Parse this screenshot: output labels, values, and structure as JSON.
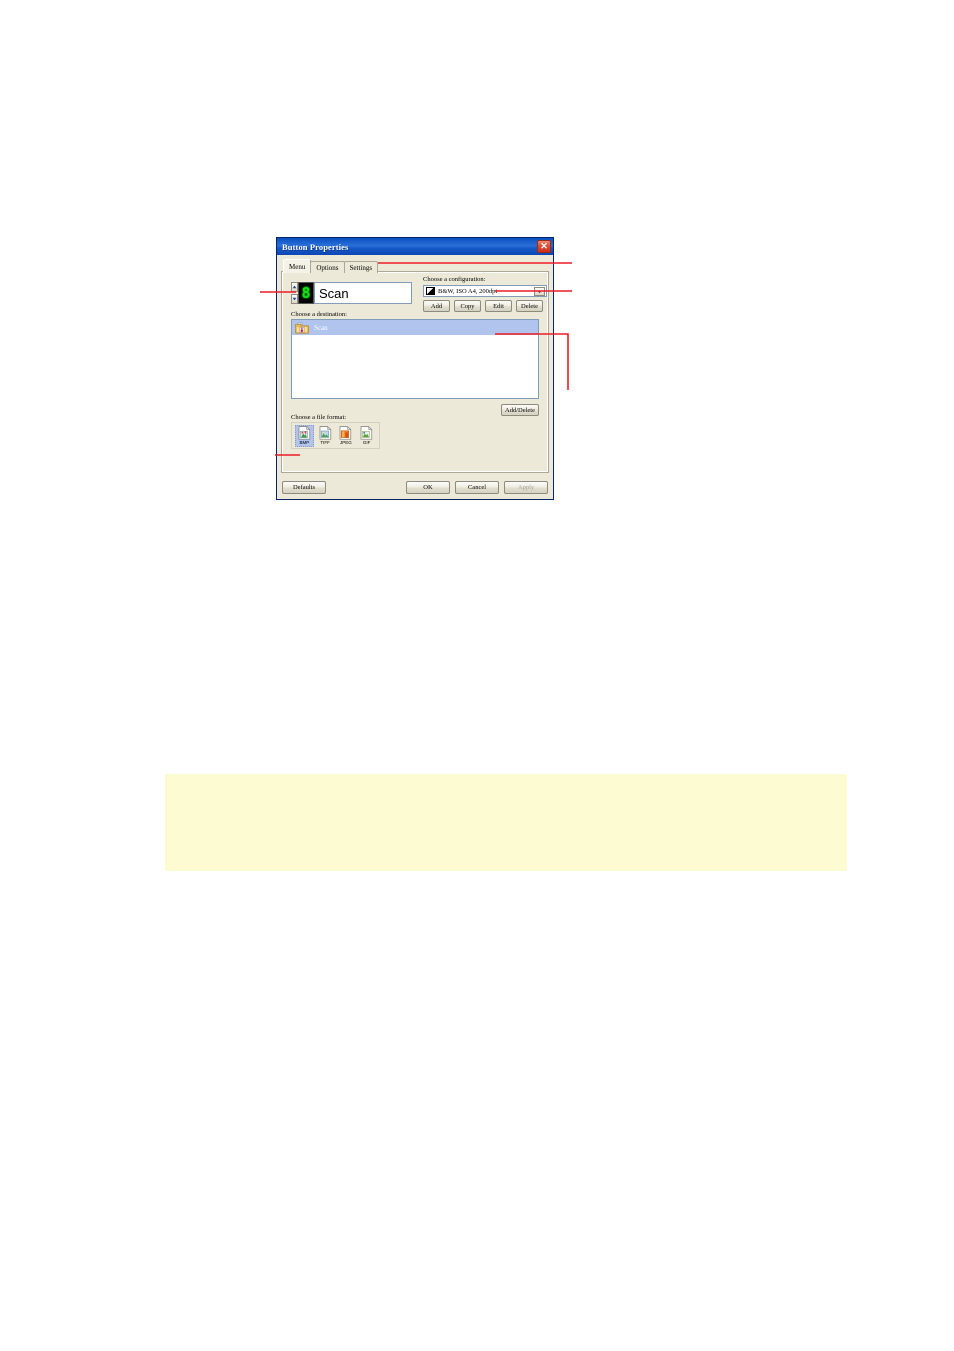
{
  "dialog": {
    "title": "Button Properties",
    "close_icon": "close-icon",
    "tabs": [
      {
        "label": "Menu",
        "active": true
      },
      {
        "label": "Options",
        "active": false
      },
      {
        "label": "Settings",
        "active": false
      }
    ],
    "button_number": {
      "value": "8",
      "spin_up_icon": "chevron-up-icon",
      "spin_down_icon": "chevron-down-icon"
    },
    "button_name": {
      "value": "Scan",
      "placeholder": ""
    },
    "configuration": {
      "label": "Choose a configuration:",
      "selected": "B&W, ISO A4, 200dpi",
      "dropdown_icon": "chevron-down-icon",
      "profile_icon": "bw-profile-icon",
      "buttons": [
        {
          "label": "Add"
        },
        {
          "label": "Copy"
        },
        {
          "label": "Edit"
        },
        {
          "label": "Delete"
        }
      ]
    },
    "destination": {
      "label": "Choose a destination:",
      "items": [
        {
          "label": "Scan",
          "icon": "scan-folder-icon",
          "selected": true
        }
      ],
      "add_delete_label": "Add/Delete"
    },
    "file_format": {
      "label": "Choose a file format:",
      "items": [
        {
          "caption": "BMP",
          "icon": "bmp-file-icon",
          "selected": true
        },
        {
          "caption": "TIFF",
          "icon": "tiff-file-icon",
          "selected": false
        },
        {
          "caption": "JPEG",
          "icon": "jpeg-file-icon",
          "selected": false
        },
        {
          "caption": "GIF",
          "icon": "gif-file-icon",
          "selected": false
        }
      ]
    },
    "footer": {
      "defaults": "Defaults",
      "ok": "OK",
      "cancel": "Cancel",
      "apply": "Apply",
      "apply_disabled": true
    }
  },
  "annotations": {
    "color": "#ee1c25",
    "callouts": [
      {
        "name": "button-number-callout",
        "target": "button-number-spinner"
      },
      {
        "name": "tabs-callout",
        "target": "tabstrip"
      },
      {
        "name": "configuration-callout",
        "target": "configuration-combo"
      },
      {
        "name": "destination-callout",
        "target": "destination-listbox"
      },
      {
        "name": "file-format-callout",
        "target": "file-format-bmp"
      }
    ]
  },
  "note_box": {
    "text": "",
    "background": "#fdfbd1"
  }
}
